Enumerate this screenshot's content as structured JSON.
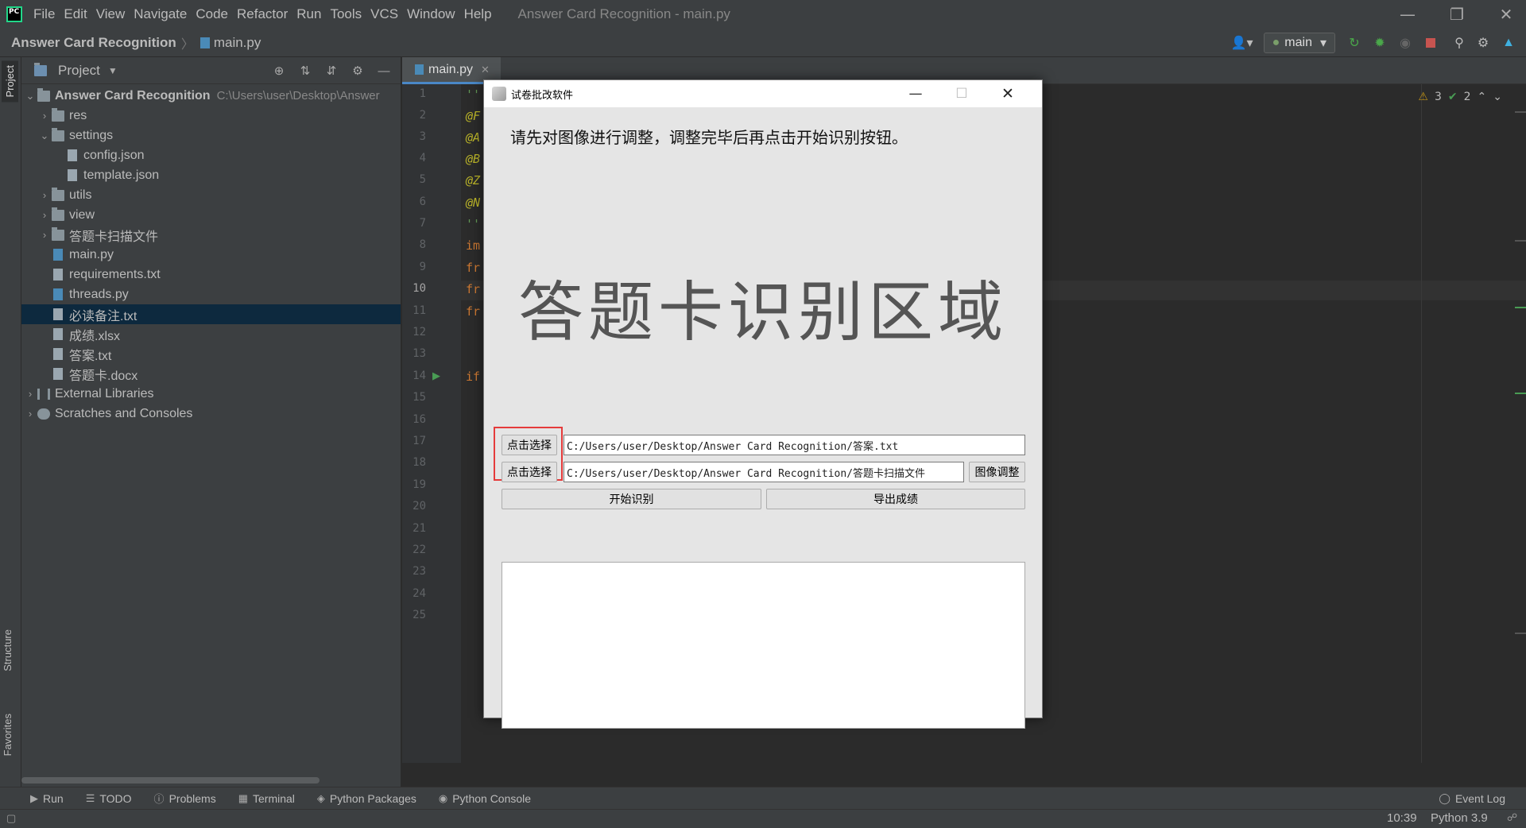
{
  "menubar": {
    "items": [
      "File",
      "Edit",
      "View",
      "Navigate",
      "Code",
      "Refactor",
      "Run",
      "Tools",
      "VCS",
      "Window",
      "Help"
    ],
    "window_title": "Answer Card Recognition - main.py"
  },
  "navbar": {
    "project": "Answer Card Recognition",
    "file": "main.py",
    "run_config": "main"
  },
  "stripe": {
    "project": "Project",
    "structure": "Structure",
    "favorites": "Favorites"
  },
  "project_panel": {
    "title": "Project",
    "root_name": "Answer Card Recognition",
    "root_path": "C:\\Users\\user\\Desktop\\Answer",
    "items": [
      {
        "label": "res",
        "kind": "folder"
      },
      {
        "label": "settings",
        "kind": "folder"
      },
      {
        "label": "config.json",
        "kind": "file"
      },
      {
        "label": "template.json",
        "kind": "file"
      },
      {
        "label": "utils",
        "kind": "folder"
      },
      {
        "label": "view",
        "kind": "folder"
      },
      {
        "label": "答题卡扫描文件",
        "kind": "folder"
      },
      {
        "label": "main.py",
        "kind": "py"
      },
      {
        "label": "requirements.txt",
        "kind": "file"
      },
      {
        "label": "threads.py",
        "kind": "py"
      },
      {
        "label": "必读备注.txt",
        "kind": "file"
      },
      {
        "label": "成绩.xlsx",
        "kind": "file"
      },
      {
        "label": "答案.txt",
        "kind": "file"
      },
      {
        "label": "答题卡.docx",
        "kind": "file"
      },
      {
        "label": "External Libraries",
        "kind": "lib"
      },
      {
        "label": "Scratches and Consoles",
        "kind": "scratch"
      }
    ]
  },
  "editor": {
    "tab": "main.py",
    "line_numbers": [
      "1",
      "2",
      "3",
      "4",
      "5",
      "6",
      "7",
      "8",
      "9",
      "10",
      "11",
      "12",
      "13",
      "14",
      "15",
      "16",
      "17",
      "18",
      "19",
      "20",
      "21",
      "22",
      "23",
      "24",
      "25"
    ],
    "code": {
      "l1": "''",
      "l2": "@F",
      "l3": "@A",
      "l4": "@B",
      "l5": "@Z",
      "l6": "@N",
      "l7": "''",
      "l8": "im",
      "l9": "fr",
      "l10": "fr",
      "l11": "fr",
      "l14": "if"
    },
    "warnings": "3",
    "checks": "2"
  },
  "dialog": {
    "title": "试卷批改软件",
    "instruction": "请先对图像进行调整，调整完毕后再点击开始识别按钮。",
    "recognition_area": "答题卡识别区域",
    "select_button_1": "点击选择",
    "select_button_2": "点击选择",
    "answer_path": "C:/Users/user/Desktop/Answer Card Recognition/答案.txt",
    "scan_path": "C:/Users/user/Desktop/Answer Card Recognition/答题卡扫描文件",
    "adjust_button": "图像调整",
    "start_button": "开始识别",
    "export_button": "导出成绩",
    "log_text": ""
  },
  "bottom": {
    "tabs": [
      "Run",
      "TODO",
      "Problems",
      "Terminal",
      "Python Packages",
      "Python Console"
    ],
    "event_log": "Event Log",
    "time": "10:39",
    "interpreter": "Python 3.9"
  },
  "colors": {
    "ide_bg": "#2b2b2b",
    "panel_bg": "#3c3f41",
    "selection": "#0d293e",
    "highlight": "#e53b3b"
  }
}
